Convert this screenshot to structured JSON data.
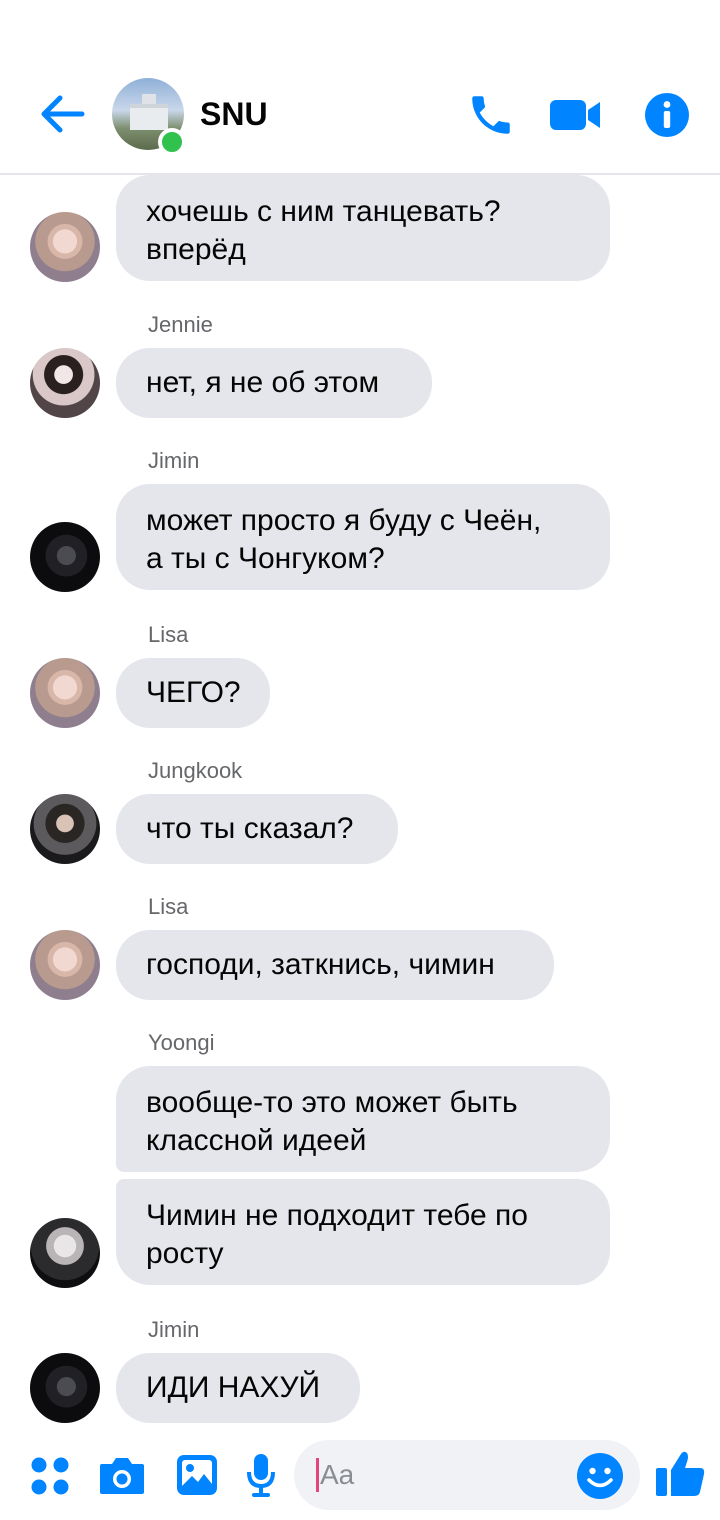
{
  "header": {
    "title": "SNU",
    "back_icon": "back-arrow-icon",
    "actions": [
      "phone-icon",
      "video-camera-icon",
      "info-icon"
    ],
    "accent": "#0084ff",
    "online_color": "#31c24d"
  },
  "messages": [
    {
      "sender": "",
      "lines": [
        "хочешь с ним танцевать?",
        "вперёд"
      ]
    },
    {
      "sender": "Jennie",
      "lines": [
        "нет, я не об этом"
      ]
    },
    {
      "sender": "Jimin",
      "lines": [
        "может просто я буду с Чеён,",
        "а ты с Чонгуком?"
      ]
    },
    {
      "sender": "Lisa",
      "lines": [
        "ЧЕГО?"
      ]
    },
    {
      "sender": "Jungkook",
      "lines": [
        "что ты сказал?"
      ]
    },
    {
      "sender": "Lisa",
      "lines": [
        "господи, заткнись, чимин"
      ]
    },
    {
      "sender": "Yoongi",
      "lines": [
        "вообще-то это может быть",
        "классной идеей"
      ]
    },
    {
      "sender": "",
      "lines": [
        "Чимин не подходит тебе по",
        "росту"
      ]
    },
    {
      "sender": "Jimin",
      "lines": [
        "ИДИ НАХУЙ"
      ]
    }
  ],
  "composer": {
    "placeholder": "Aa",
    "icons": [
      "apps-icon",
      "camera-icon",
      "gallery-icon",
      "microphone-icon",
      "emoji-icon",
      "thumbs-up-icon"
    ]
  },
  "bubble_color": "#e4e6eb"
}
